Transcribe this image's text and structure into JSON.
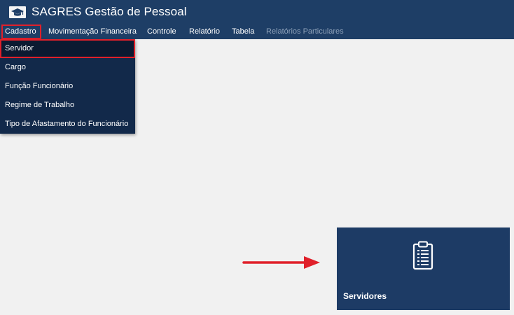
{
  "app": {
    "title": "SAGRES Gestão de Pessoal",
    "logo_icon": "graduation-cap-icon"
  },
  "menu": {
    "items": [
      {
        "label": "Cadastro",
        "state": "open"
      },
      {
        "label": "Movimentação Financeira",
        "state": "normal"
      },
      {
        "label": "Controle",
        "state": "normal"
      },
      {
        "label": "Relatório",
        "state": "normal"
      },
      {
        "label": "Tabela",
        "state": "normal"
      },
      {
        "label": "Relatórios Particulares",
        "state": "disabled"
      }
    ]
  },
  "dropdown": {
    "items": [
      {
        "label": "Servidor",
        "state": "highlighted"
      },
      {
        "label": "Cargo"
      },
      {
        "label": "Função Funcionário"
      },
      {
        "label": "Regime de Trabalho"
      },
      {
        "label": "Tipo de Afastamento do Funcionário"
      }
    ]
  },
  "tile": {
    "label": "Servidores",
    "icon": "clipboard-list-icon"
  },
  "annotation": {
    "arrow_icon": "arrow-right-icon"
  },
  "colors": {
    "header_bg": "#1e3e66",
    "dropdown_bg": "#12294a",
    "tile_bg": "#1d3b65",
    "highlight_red": "#e0202a",
    "page_bg": "#f1f1f1"
  }
}
